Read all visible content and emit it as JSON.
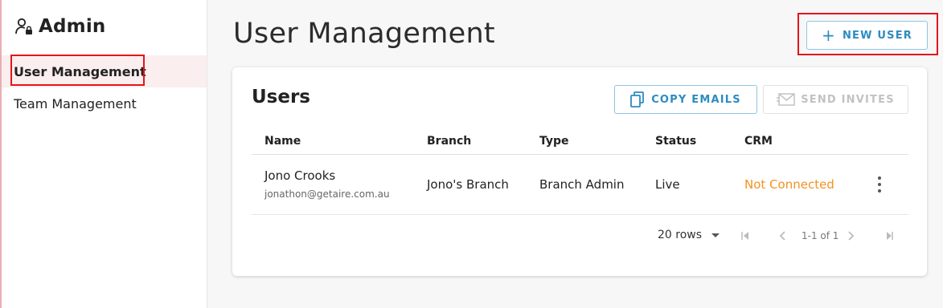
{
  "sidebar": {
    "title": "Admin",
    "items": [
      {
        "label": "User Management",
        "active": true
      },
      {
        "label": "Team Management",
        "active": false
      }
    ]
  },
  "header": {
    "title": "User Management",
    "new_user_label": "NEW USER"
  },
  "users_card": {
    "title": "Users",
    "copy_emails_label": "COPY EMAILS",
    "send_invites_label": "SEND INVITES",
    "columns": [
      "Name",
      "Branch",
      "Type",
      "Status",
      "CRM"
    ],
    "rows": [
      {
        "name": "Jono Crooks",
        "email": "jonathon@getaire.com.au",
        "branch": "Jono's Branch",
        "type": "Branch Admin",
        "status": "Live",
        "crm": "Not Connected"
      }
    ],
    "pagination": {
      "rows_per_page": "20 rows",
      "page_info": "1-1 of 1"
    }
  },
  "colors": {
    "accent": "#2d8bc0",
    "crm_warning": "#f39221",
    "highlight": "#e3141b",
    "active_nav_bg": "#fbeeee"
  },
  "icons": {
    "sidebar": "user-lock-icon",
    "new_user": "plus-icon",
    "copy_emails": "copy-icon",
    "send_invites": "mail-icon",
    "row_menu": "more-vertical-icon",
    "rows_dropdown": "caret-down-icon",
    "first_page": "first-page-icon",
    "prev_page": "chevron-left-icon",
    "next_page": "chevron-right-icon",
    "last_page": "last-page-icon"
  }
}
